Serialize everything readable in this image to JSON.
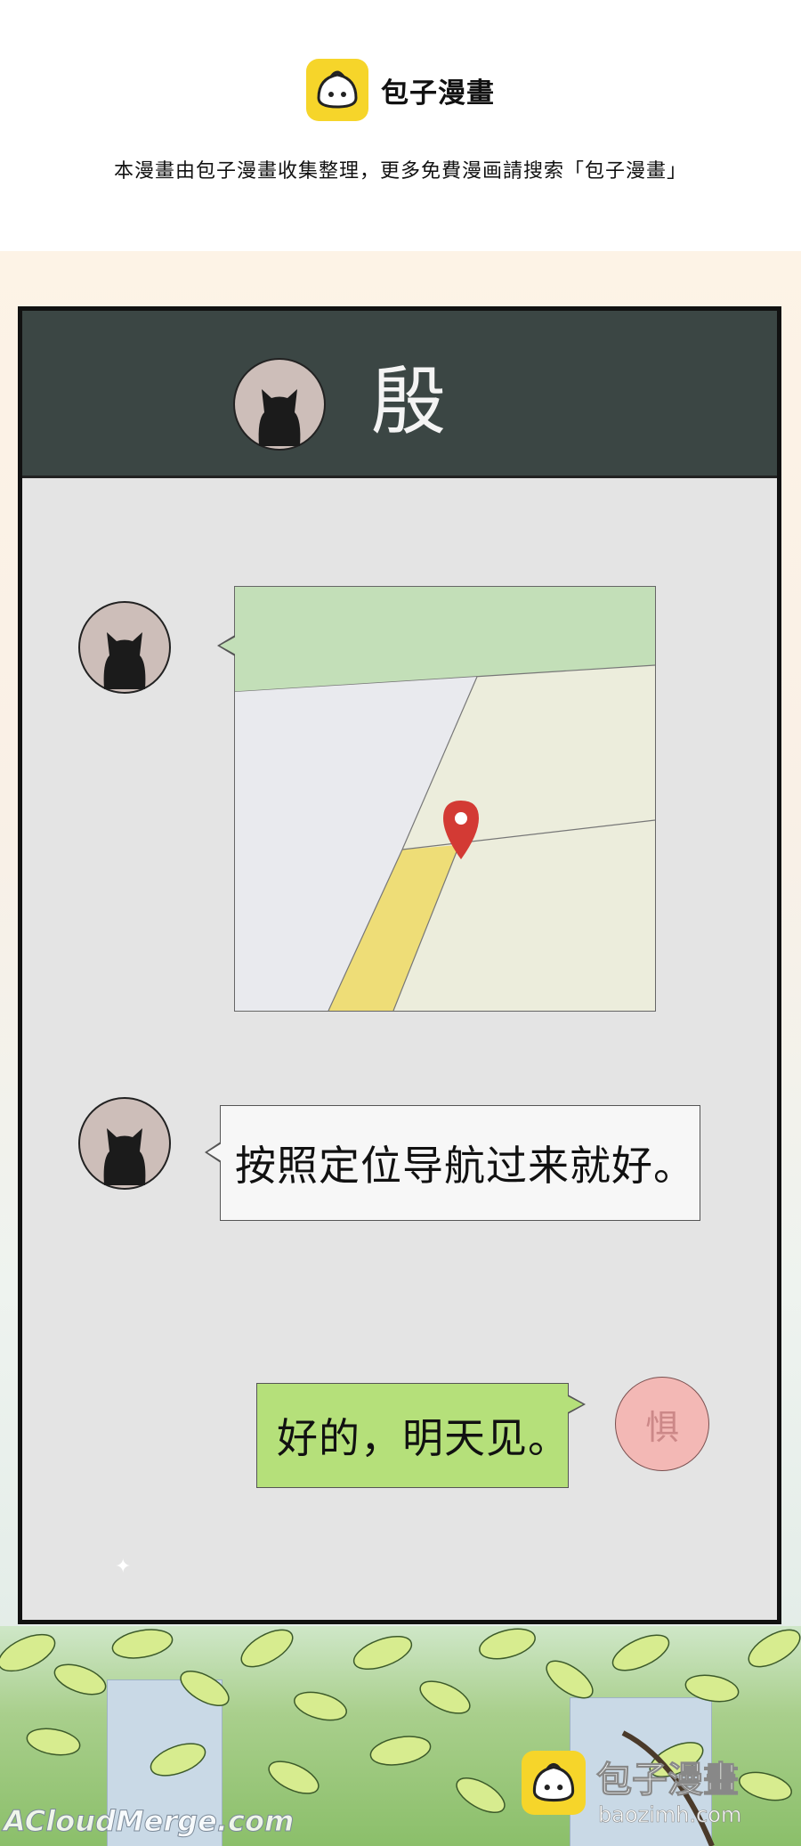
{
  "header": {
    "brand_name": "包子漫畫",
    "notice": "本漫畫由包子漫畫收集整理，更多免費漫画請搜索「包子漫畫」",
    "logo_icon": "bun-logo-icon",
    "brand_color": "#f6d52a"
  },
  "chat": {
    "contact_name": "殷",
    "header_color": "#3b4644",
    "contact_avatar_icon": "black-cat-avatar-icon",
    "messages": [
      {
        "sender": "contact",
        "kind": "location-map",
        "pin_icon": "map-pin-icon"
      },
      {
        "sender": "contact",
        "kind": "text",
        "text": "按照定位导航过来就好。"
      },
      {
        "sender": "self",
        "kind": "text",
        "text": "好的，明天见。",
        "bubble_color": "#b5e07a"
      }
    ],
    "self_avatar_char": "惧",
    "self_avatar_color": "#f3b8b5"
  },
  "footer": {
    "watermark": "ACloudMerge.com",
    "brand_name": "包子漫畫",
    "domain": "baozimh.com"
  }
}
